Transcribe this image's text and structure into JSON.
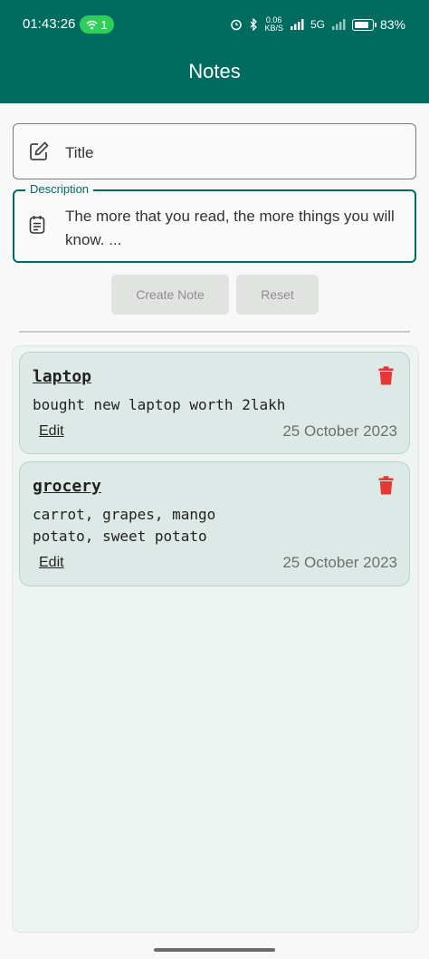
{
  "status_bar": {
    "time": "01:43:26",
    "hotspot_count": "1",
    "net_speed_top": "0.06",
    "net_speed_bottom": "KB/S",
    "signal_label": "5G",
    "battery_percent": "83%",
    "battery_level": 0.83
  },
  "app_bar": {
    "title": "Notes"
  },
  "form": {
    "title_field": {
      "icon": "edit-icon",
      "placeholder": "Title"
    },
    "description_field": {
      "icon": "note-list-icon",
      "label": "Description",
      "value": "The more that you read, the more things you will know. ..."
    },
    "buttons": {
      "create": "Create Note",
      "reset": "Reset"
    }
  },
  "notes": [
    {
      "title": "laptop",
      "body": "bought new laptop worth 2lakh",
      "edit_label": "Edit",
      "date": "25 October 2023"
    },
    {
      "title": "grocery",
      "body": "carrot, grapes, mango\npotato, sweet potato",
      "edit_label": "Edit",
      "date": "25 October 2023"
    }
  ],
  "colors": {
    "primary": "#006b5f",
    "delete": "#e53935",
    "card_bg": "#dde9e6",
    "hotspot": "#2fcf5a"
  }
}
